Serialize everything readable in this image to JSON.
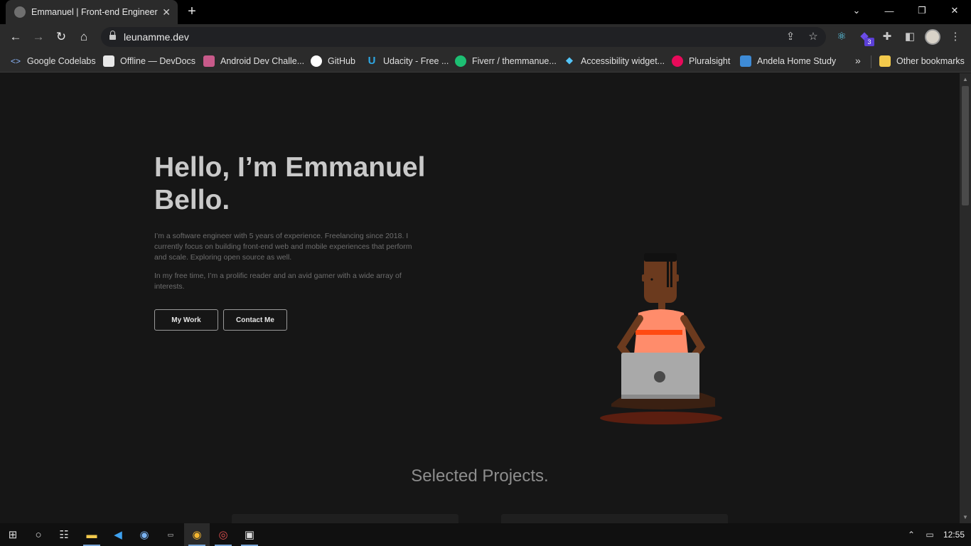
{
  "browser": {
    "tab_title": "Emmanuel | Front-end Engineer",
    "url": "leunamme.dev",
    "extension_badge": "3"
  },
  "bookmarks": [
    {
      "label": "Google Codelabs",
      "icon": "code-brackets-icon",
      "color": "#8ab4f8"
    },
    {
      "label": "Offline — DevDocs",
      "icon": "devdocs-icon",
      "color": "#e8e8e8"
    },
    {
      "label": "Android Dev Challe...",
      "icon": "android-dev-icon",
      "color": "#c85a8a"
    },
    {
      "label": "GitHub",
      "icon": "github-icon",
      "color": "#ffffff"
    },
    {
      "label": "Udacity - Free ...",
      "icon": "udacity-icon",
      "color": "#2ea8e5"
    },
    {
      "label": "Fiverr / themmanue...",
      "icon": "fiverr-icon",
      "color": "#1dbf73"
    },
    {
      "label": "Accessibility widget...",
      "icon": "flutter-icon",
      "color": "#54c5f8"
    },
    {
      "label": "Pluralsight",
      "icon": "pluralsight-icon",
      "color": "#e80a5a"
    },
    {
      "label": "Andela Home Study",
      "icon": "andela-icon",
      "color": "#3e8bd6"
    }
  ],
  "other_bookmarks": "Other bookmarks",
  "hero": {
    "title_line1": "Hello, I’m Emmanuel",
    "title_line2": "Bello.",
    "para1_line1": "I’m a software engineer with 5 years of experience. Freelancing since 2018. I",
    "para1_line2": "currently focus on building front-end web and mobile experiences that perform",
    "para1_line3": "and scale. Exploring open source as well.",
    "para2_line1": "In my free time, I’m a prolific reader and an avid gamer with a wide array of",
    "para2_line2": "interests.",
    "my_work": "My Work",
    "contact_me": "Contact Me"
  },
  "projects": {
    "heading": "Selected Projects."
  },
  "taskbar": {
    "time": "12:55"
  },
  "colors": {
    "page_bg": "#161616",
    "shirt": "#ff8c6b",
    "stripe": "#ff4a12",
    "skin": "#6b3a1e",
    "laptop": "#a9a9a9",
    "mat": "#5a1e10"
  }
}
